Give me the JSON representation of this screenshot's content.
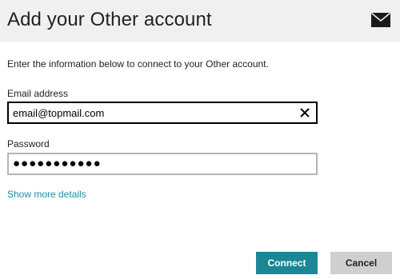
{
  "header": {
    "title": "Add your Other account",
    "icon": "mail-icon"
  },
  "intro_text": "Enter the information below to connect to your Other account.",
  "email": {
    "label": "Email address",
    "value": "email@topmail.com",
    "clear_icon": "close-icon"
  },
  "password": {
    "label": "Password",
    "value": "●●●●●●●●●●●"
  },
  "more_link": "Show more details",
  "buttons": {
    "connect": "Connect",
    "cancel": "Cancel"
  },
  "colors": {
    "header_bg": "#f0f0f0",
    "accent": "#1a8797",
    "link": "#1c8da7",
    "cancel_bg": "#cfcfcf"
  }
}
